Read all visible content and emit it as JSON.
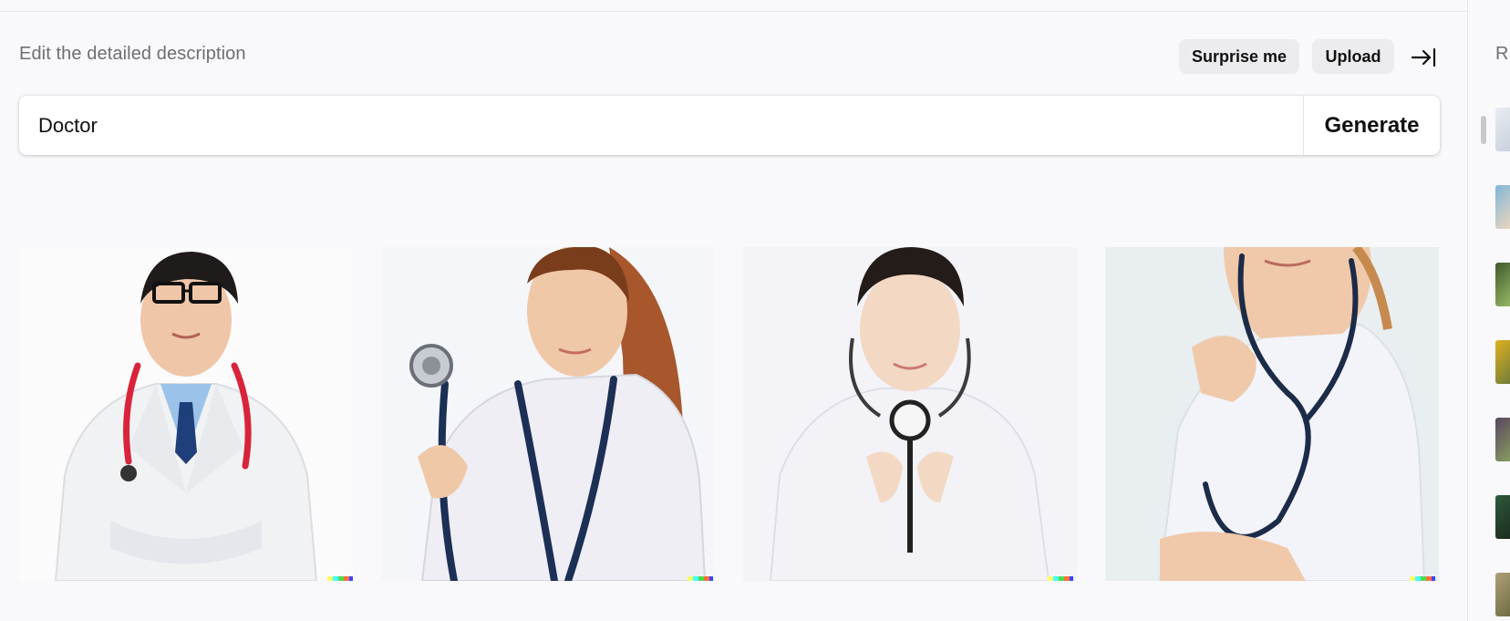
{
  "header": {
    "hint": "Edit the detailed description",
    "surprise_label": "Surprise me",
    "upload_label": "Upload"
  },
  "prompt": {
    "value": "Doctor",
    "generate_label": "Generate"
  },
  "results": [
    {
      "name": "doctor-image-1",
      "subject": "male doctor with glasses, red stethoscope, arms crossed"
    },
    {
      "name": "doctor-image-2",
      "subject": "female doctor holding stethoscope"
    },
    {
      "name": "doctor-image-3",
      "subject": "female doctor holding stethoscope chest piece"
    },
    {
      "name": "doctor-image-4",
      "subject": "female doctor with stethoscope around neck"
    }
  ],
  "sidebar": {
    "heading": "R"
  },
  "colors": {
    "background": "#f9f9fb",
    "button_bg": "#ececef",
    "hint_text": "#6e6e73"
  }
}
